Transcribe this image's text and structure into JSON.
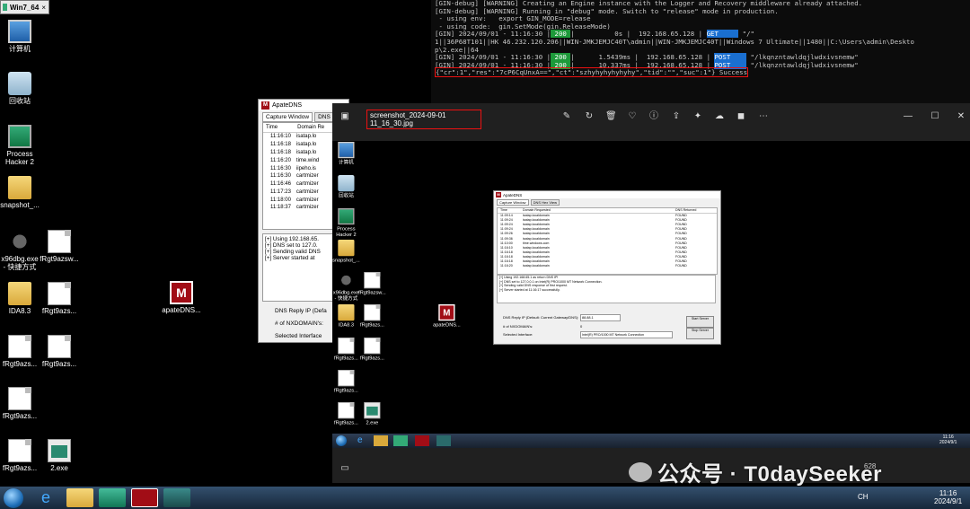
{
  "vm_tab": {
    "label": "Win7_64"
  },
  "desktop": {
    "icons": [
      {
        "label": "计算机"
      },
      {
        "label": "回收站"
      },
      {
        "label": "Process\nHacker 2"
      },
      {
        "label": "snapshot_..."
      },
      {
        "label": "x96dbg.exe\n- 快捷方式"
      },
      {
        "label": "fRgt9azsw..."
      },
      {
        "label": "IDA8.3"
      },
      {
        "label": "fRgt9azs..."
      },
      {
        "label": "apateDNS..."
      },
      {
        "label": "fRgt9azs..."
      },
      {
        "label": "fRgt9azs..."
      },
      {
        "label": "fRgt9azs..."
      },
      {
        "label": "fRgt9azs..."
      },
      {
        "label": "2.exe"
      }
    ]
  },
  "console": {
    "lines": [
      "[GIN-debug] [WARNING] Creating an Engine instance with the Logger and Recovery middleware already attached.",
      "",
      "[GIN-debug] [WARNING] Running in \"debug\" mode. Switch to \"release\" mode in production.",
      " - using env:   export GIN_MODE=release",
      " - using code:  gin.SetMode(gin.ReleaseMode)",
      ""
    ],
    "req1": {
      "prefix": "[GIN] 2024/09/01 - 11:16:30 |",
      "status": " 200 ",
      "mid": "|          0s |  192.168.65.128 |",
      "method": "GET     ",
      "path": "\"/\""
    },
    "agent_line1": "1||36P68T101||HK 46.232.120.206||WIN-JMKJEMJC40T\\admin||WIN-JMKJEMJC40T||Windows 7 Ultimate||1480||C:\\Users\\admin\\Deskto",
    "agent_line2": "p\\2.exe||64",
    "req2": {
      "prefix": "[GIN] 2024/09/01 - 11:16:30 |",
      "status": " 200 ",
      "mid": "|      1.5439ms |  192.168.65.128 |",
      "method": "POST    ",
      "path": "\"/lkqnzntawldqjlwdxivsnemw\""
    },
    "req3": {
      "prefix": "[GIN] 2024/09/01 - 11:16:30 |",
      "status": " 200 ",
      "mid": "|      10.337ms |  192.168.65.128 |",
      "method": "POST    ",
      "path": "\"/lkqnzntawldqjlwdxivsnemw\""
    },
    "boxed": "{\"cr\":1\",\"res\":\"7cP6CqUnxA==\",\"ct\":\"szhyhyhyhyhyhy\",\"tid\":\"\",\"suc\":1\"} Success"
  },
  "apate_left": {
    "title": "ApateDNS",
    "tabs": [
      "Capture Window",
      "DNS He"
    ],
    "columns": [
      "Time",
      "Domain Re"
    ],
    "rows": [
      {
        "time": "11:16:10",
        "domain": "isatap.lo"
      },
      {
        "time": "11:16:18",
        "domain": "isatap.lo"
      },
      {
        "time": "11:16:18",
        "domain": "isatap.lo"
      },
      {
        "time": "11:16:20",
        "domain": "time.wind"
      },
      {
        "time": "11:16:30",
        "domain": "iipeho.is"
      },
      {
        "time": "11:16:30",
        "domain": "cartmizer"
      },
      {
        "time": "11:16:46",
        "domain": "cartmizer"
      },
      {
        "time": "11:17:23",
        "domain": "cartmizer"
      },
      {
        "time": "11:18:00",
        "domain": "cartmizer"
      },
      {
        "time": "11:18:37",
        "domain": "cartmizer"
      }
    ],
    "log": [
      "[+] Using 192.168.65.",
      "[+] DNS set to 127.0.",
      "[+] Sending valid DNS",
      "[+] Server started at"
    ],
    "dns_reply_label": "DNS Reply IP (Defa",
    "nxdomain_label": "# of NXDOMAIN's:",
    "interface_label": "Selected Interface"
  },
  "viewer": {
    "filename": "screenshot_2024-09-01 11_16_30.jpg",
    "zoom_hint": "628"
  },
  "inner": {
    "desktop_labels": [
      "计算机",
      "回收站",
      "Process\nHacker 2",
      "snapshot_...",
      "x96dbg.exe\n- 快捷方式",
      "fRgt9azsw...",
      "IDA8.3",
      "fRgt9azs...",
      "apateDNS...",
      "fRgt9azs...",
      "fRgt9azs...",
      "fRgt9azs...",
      "fRgt9azs...",
      "2.exe"
    ],
    "apate": {
      "title": "ApateDNS",
      "tabs": [
        "Capture Window",
        "DNS Hex View"
      ],
      "columns": [
        "Time",
        "Domain Requested",
        "DNS Returned"
      ],
      "rows": [
        {
          "time": "11:09:14",
          "domain": "isatap.localdomain",
          "ret": "FOUND"
        },
        {
          "time": "11:09:24",
          "domain": "isatap.localdomain",
          "ret": "FOUND"
        },
        {
          "time": "11:09:24",
          "domain": "isatap.localdomain",
          "ret": "FOUND"
        },
        {
          "time": "11:09:24",
          "domain": "isatap.localdomain",
          "ret": "FOUND"
        },
        {
          "time": "11:09:26",
          "domain": "isatap.localdomain",
          "ret": "FOUND"
        },
        {
          "time": "11:09:36",
          "domain": "isatap.localdomain",
          "ret": "FOUND"
        },
        {
          "time": "11:10:00",
          "domain": "time.windows.com",
          "ret": "FOUND"
        },
        {
          "time": "11:16:10",
          "domain": "isatap.localdomain",
          "ret": "FOUND"
        },
        {
          "time": "11:16:18",
          "domain": "isatap.localdomain",
          "ret": "FOUND"
        },
        {
          "time": "11:16:18",
          "domain": "isatap.localdomain",
          "ret": "FOUND"
        },
        {
          "time": "11:16:18",
          "domain": "isatap.localdomain",
          "ret": "FOUND"
        },
        {
          "time": "11:16:20",
          "domain": "isatap.localdomain",
          "ret": "FOUND"
        }
      ],
      "log": [
        "[+] Using 192.168.65.1 as return DNS IP!",
        "[+] DNS set to 127.0.0.1 on Intel(R) PRO/1000 MT Network Connection.",
        "[+] Sending valid DNS response of first request.",
        "[+] Server started at 11:16:17 successfully."
      ],
      "dns_reply_label": "DNS Reply IP (Default: Current Gateway/DNS):",
      "dns_reply_value": "88.88.1",
      "nxdomain_label": "# of NXDOMAIN's:",
      "nxdomain_value": "0",
      "interface_label": "Selected Interface:",
      "interface_value": "Intel(R) PRO/1000 MT Network Connection",
      "start_btn": "Start Server",
      "stop_btn": "Stop Server"
    },
    "clock_time": "11:16",
    "clock_date": "2024/9/1"
  },
  "taskbar": {
    "lang": "CH",
    "clock_time": "11:16",
    "clock_date": "2024/9/1"
  },
  "watermark": {
    "text": "公众号 · T0daySeeker"
  }
}
